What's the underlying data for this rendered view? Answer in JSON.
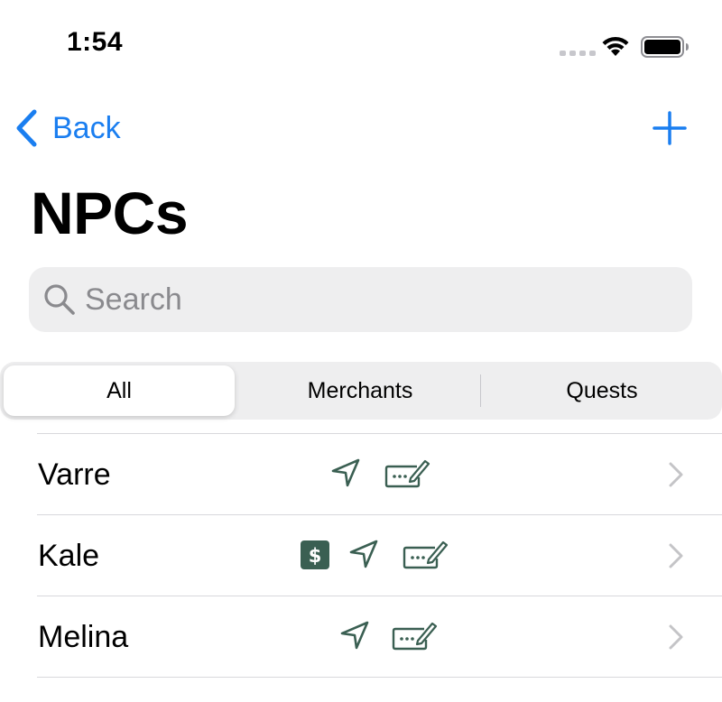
{
  "status": {
    "time": "1:54"
  },
  "nav": {
    "back_label": "Back"
  },
  "page": {
    "title": "NPCs"
  },
  "search": {
    "placeholder": "Search",
    "value": ""
  },
  "segments": {
    "items": [
      "All",
      "Merchants",
      "Quests"
    ],
    "selected": "All"
  },
  "npcs": [
    {
      "name": "Varre",
      "icons": [
        "navigation-icon",
        "ticket-edit-icon"
      ]
    },
    {
      "name": "Kale",
      "icons": [
        "dollar-icon",
        "navigation-icon",
        "ticket-edit-icon"
      ]
    },
    {
      "name": "Melina",
      "icons": [
        "navigation-icon",
        "ticket-edit-icon"
      ]
    }
  ],
  "colors": {
    "accent": "#1a7ef0",
    "icon_green": "#3a5f52",
    "chevron": "#c4c4c7"
  }
}
